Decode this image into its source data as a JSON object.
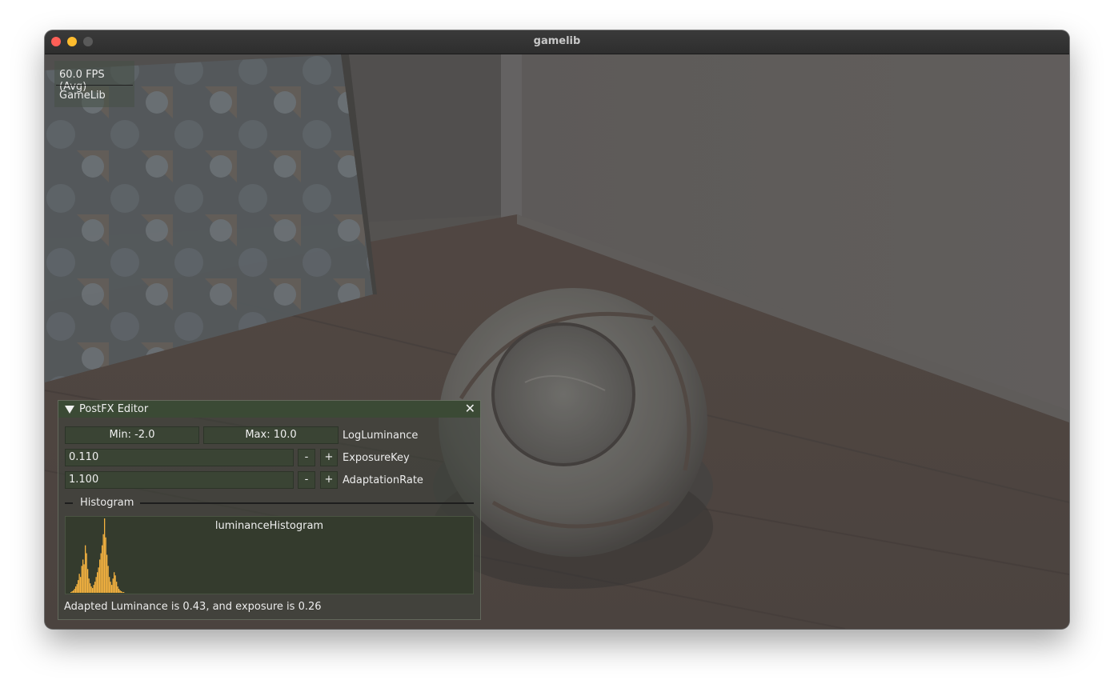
{
  "window": {
    "title": "gamelib"
  },
  "overlay": {
    "fps": "60.0 FPS (Avg)",
    "app": "GameLib"
  },
  "postfx": {
    "title": "PostFX Editor",
    "min_label": "Min: -2.0",
    "max_label": "Max: 10.0",
    "log_luminance_label": "LogLuminance",
    "exposure_key_value": "0.110",
    "exposure_key_label": "ExposureKey",
    "adaptation_rate_value": "1.100",
    "adaptation_rate_label": "AdaptationRate",
    "minus": "-",
    "plus": "+",
    "histogram_section": "Histogram",
    "histogram_title": "luminanceHistogram",
    "status": "Adapted Luminance is 0.43, and exposure is 0.26"
  },
  "colors": {
    "histogram_bar": "#f6b340",
    "accent_header": "#3b4a35"
  },
  "chart_data": {
    "type": "bar",
    "title": "luminanceHistogram",
    "values": [
      1,
      2,
      3,
      5,
      8,
      11,
      16,
      24,
      20,
      34,
      42,
      36,
      60,
      50,
      30,
      18,
      12,
      8,
      6,
      10,
      14,
      20,
      26,
      32,
      42,
      50,
      60,
      74,
      94,
      70,
      48,
      34,
      20,
      14,
      10,
      18,
      26,
      22,
      14,
      8,
      5,
      3,
      2,
      1,
      1
    ]
  }
}
